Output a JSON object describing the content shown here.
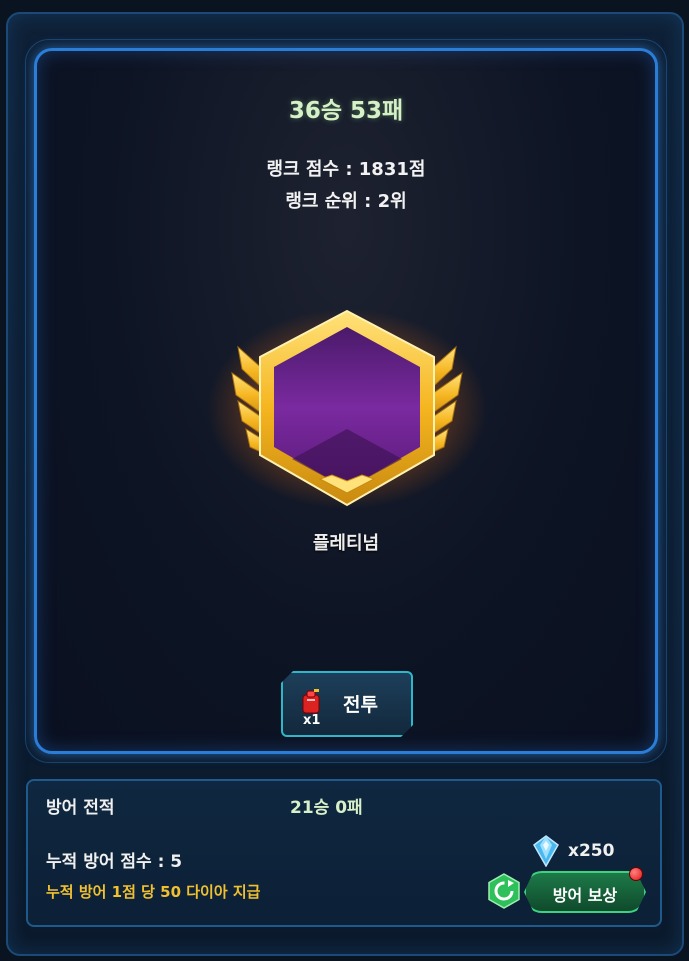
{
  "arena": {
    "record": "36승 53패",
    "rank_score": "랭크 점수 : 1831점",
    "rank_position": "랭크 순위 : 2위",
    "tier_name": "플레티넘",
    "battle": {
      "ticket_count": "x1",
      "label": "전투"
    }
  },
  "defense": {
    "label": "방어 전적",
    "record": "21승 0패",
    "score": "누적 방어 점수 : 5",
    "info": "누적 방어 1점 당 50 다이아 지급",
    "diamond_count": "x250",
    "reward_button": "방어 보상",
    "has_notification": true
  },
  "colors": {
    "accent_blue": "#2a7ed8",
    "record_green": "#d8f0c8",
    "info_gold": "#f0c030",
    "reward_green": "#3ed27e",
    "tier_purple": "#6a1c8a",
    "tier_gold": "#f5b520"
  },
  "icons": {
    "ticket": "red-ticket-icon",
    "diamond": "blue-diamond-icon",
    "refresh": "refresh-icon",
    "emblem": "platinum-rank-emblem"
  }
}
